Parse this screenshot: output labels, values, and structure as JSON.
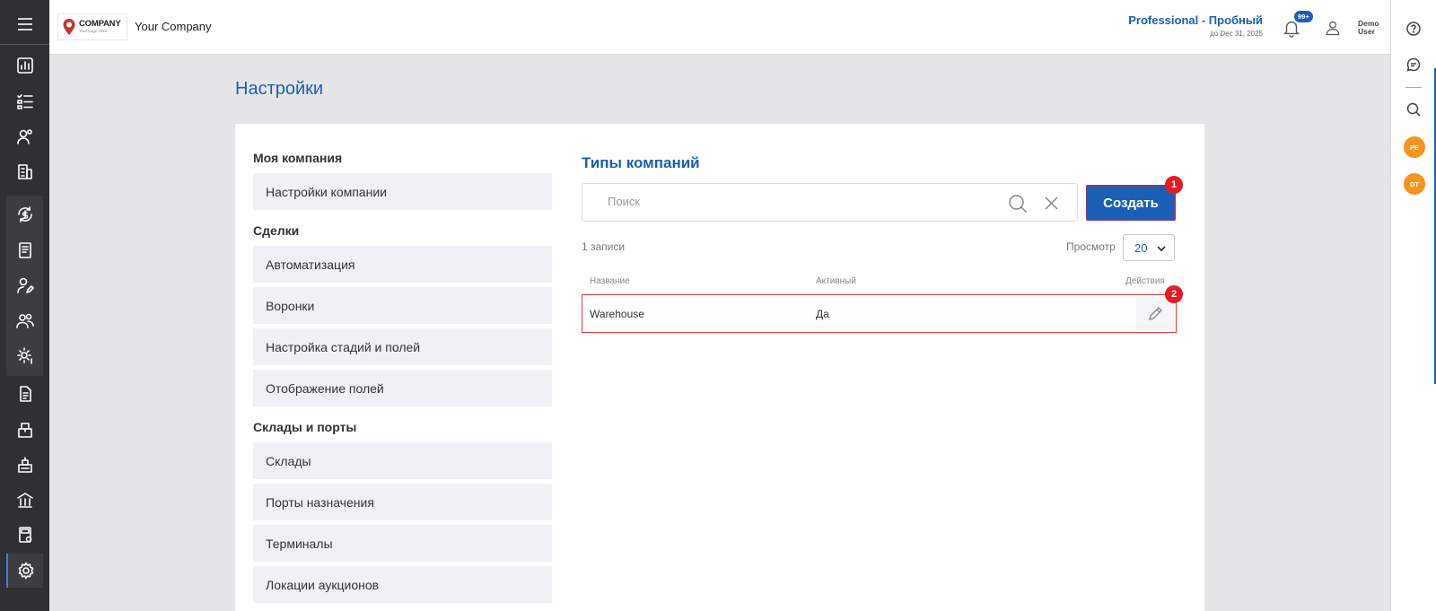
{
  "header": {
    "logo": {
      "name": "COMPANY",
      "tagline": "Your Logo Here"
    },
    "company_name": "Your Company",
    "plan": {
      "title": "Professional - Пробный",
      "expires": "до Dec 31, 2025"
    },
    "notifications_badge": "99+",
    "user": {
      "name": "Demo User"
    }
  },
  "sidebar": {
    "icons": [
      "dashboard-icon",
      "task-list-icon",
      "contacts-icon",
      "buildings-icon",
      "finance-icon",
      "book-icon",
      "user-edit-icon",
      "team-icon",
      "settings-gear-icon",
      "document-icon",
      "inventory-icon",
      "warehouse-icon",
      "bank-icon",
      "calculator-icon",
      "settings-icon"
    ],
    "active": "settings-icon"
  },
  "right_rail": {
    "badges": [
      "PE",
      "DT"
    ]
  },
  "page": {
    "title": "Настройки"
  },
  "settings_nav": {
    "sections": [
      {
        "title": "Моя компания",
        "items": [
          "Настройки компании"
        ]
      },
      {
        "title": "Сделки",
        "items": [
          "Автоматизация",
          "Воронки",
          "Настройка стадий и полей",
          "Отображение полей"
        ]
      },
      {
        "title": "Склады и порты",
        "items": [
          "Склады",
          "Порты назначения",
          "Терминалы",
          "Локации аукционов"
        ]
      }
    ]
  },
  "content": {
    "title": "Типы компаний",
    "search": {
      "placeholder": "Поиск",
      "value": ""
    },
    "create_button": "Создать",
    "records_count": "1 записи",
    "view_label": "Просмотр",
    "page_size": "20",
    "table": {
      "columns": [
        "Название",
        "Активный",
        "Действия"
      ],
      "rows": [
        {
          "name": "Warehouse",
          "active": "Да"
        }
      ]
    },
    "markers": [
      "1",
      "2"
    ]
  },
  "colors": {
    "brand_blue": "#1a5fb4",
    "sidebar_bg": "#2f3033",
    "marker_red": "#e51c23",
    "badge_orange": "#f7941d"
  }
}
